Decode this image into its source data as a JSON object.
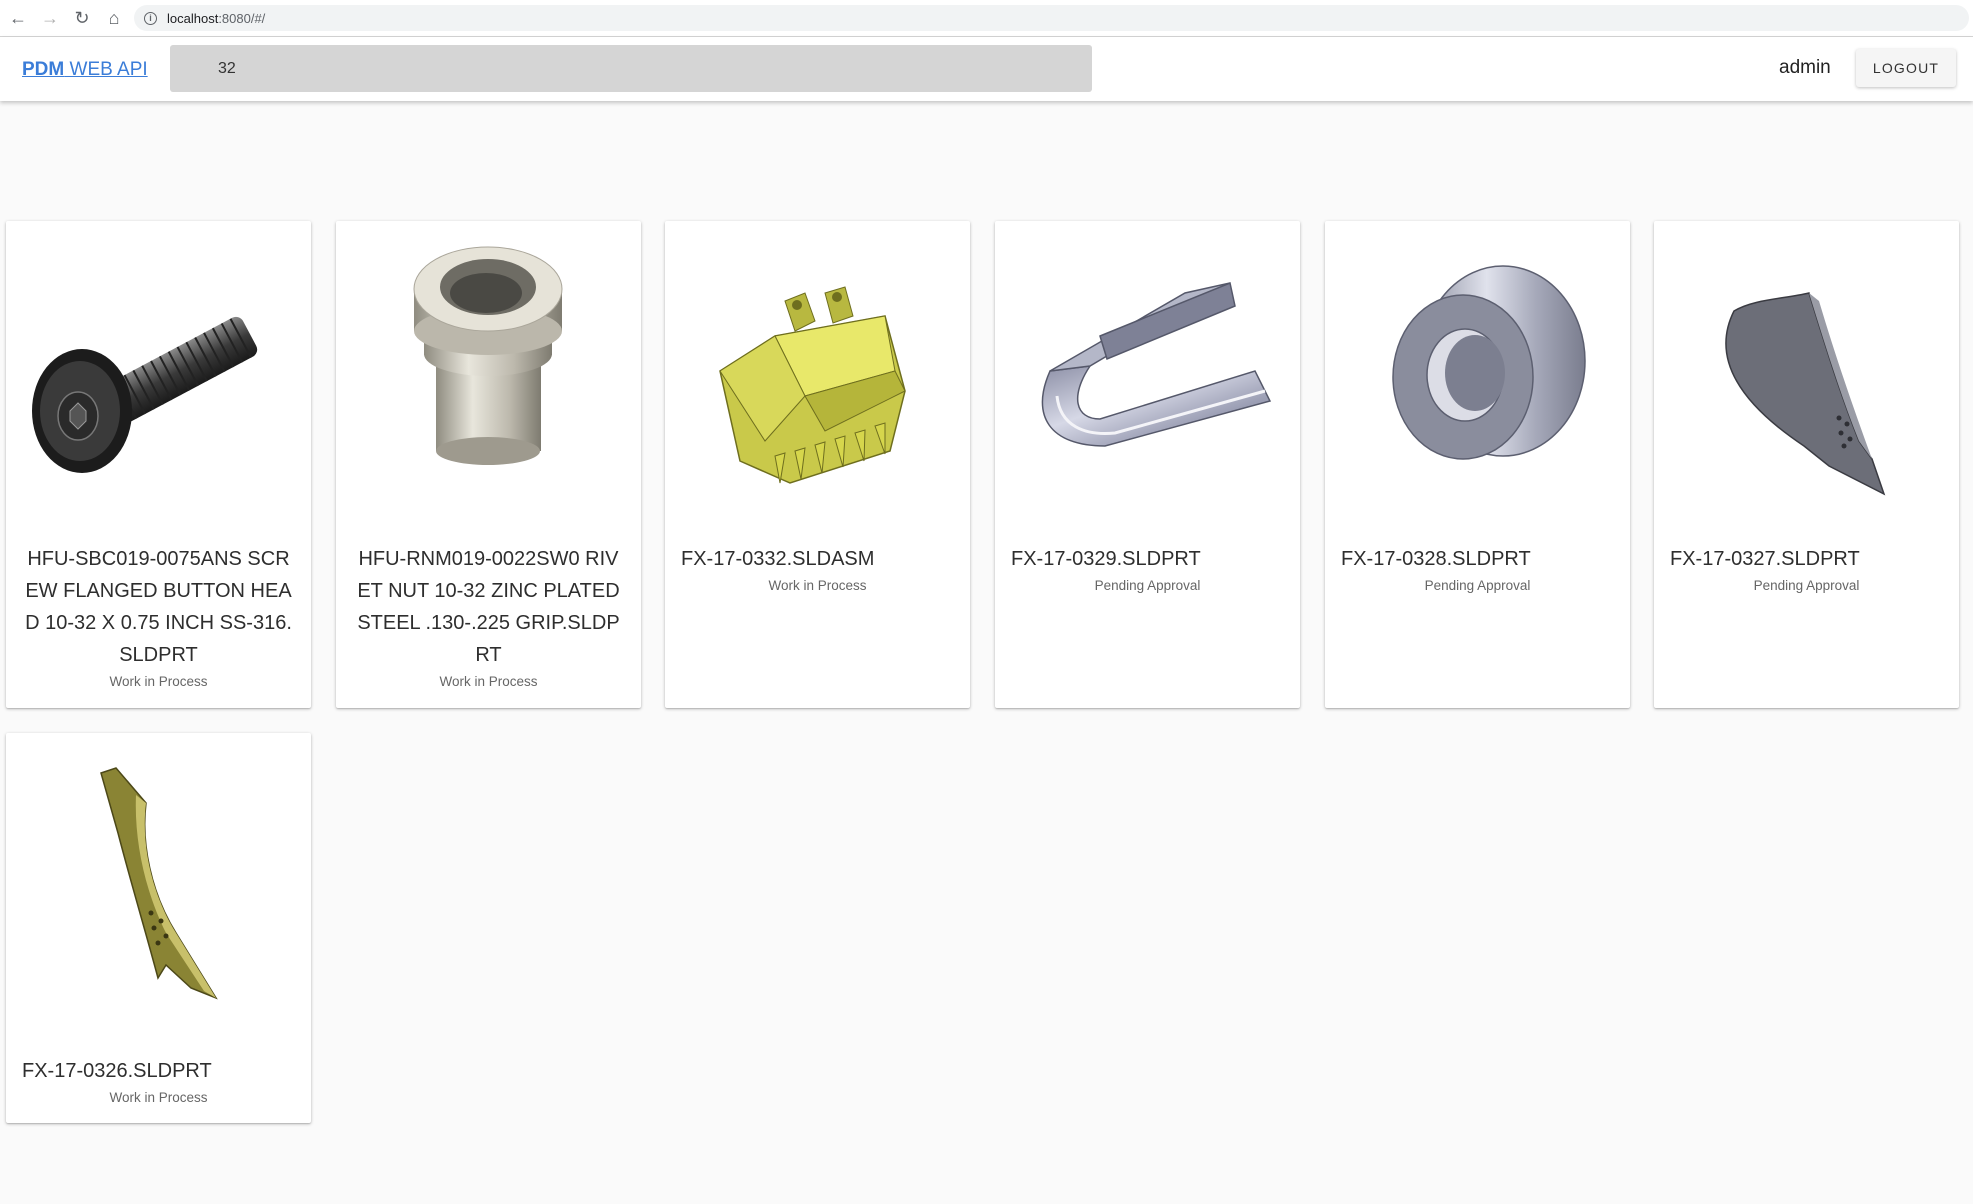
{
  "browser": {
    "url_host": "localhost",
    "url_rest": ":8080/#/"
  },
  "header": {
    "brand_bold": "PDM",
    "brand_rest": " WEB API",
    "search_value": "32",
    "user": "admin",
    "logout_label": "LOGOUT"
  },
  "cards": [
    {
      "title": "HFU-SBC019-0075ANS SCREW FLANGED BUTTON HEAD 10-32 X 0.75 INCH SS-316.SLDPRT",
      "status": "Work in Process",
      "icon": "screw-thumbnail"
    },
    {
      "title": "HFU-RNM019-0022SW0 RIVET NUT 10-32 ZINC PLATED STEEL .130-.225 GRIP.SLDPRT",
      "status": "Work in Process",
      "icon": "rivet-nut-thumbnail"
    },
    {
      "title": "FX-17-0332.SLDASM",
      "status": "Work in Process",
      "icon": "bucket-assembly-thumbnail"
    },
    {
      "title": "FX-17-0329.SLDPRT",
      "status": "Pending Approval",
      "icon": "bent-sheet-thumbnail"
    },
    {
      "title": "FX-17-0328.SLDPRT",
      "status": "Pending Approval",
      "icon": "ring-thumbnail"
    },
    {
      "title": "FX-17-0327.SLDPRT",
      "status": "Pending Approval",
      "icon": "blade-plate-thumbnail"
    },
    {
      "title": "FX-17-0326.SLDPRT",
      "status": "Work in Process",
      "icon": "side-plate-thumbnail"
    }
  ],
  "colors": {
    "brand": "#3b7dd8",
    "page_bg": "#fafafa",
    "search_bg": "#d5d5d5"
  }
}
